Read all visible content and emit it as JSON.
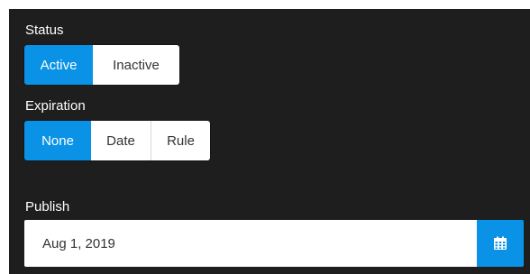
{
  "status": {
    "label": "Status",
    "options": [
      "Active",
      "Inactive"
    ],
    "selected": "Active"
  },
  "expiration": {
    "label": "Expiration",
    "options": [
      "None",
      "Date",
      "Rule"
    ],
    "selected": "None"
  },
  "publish": {
    "label": "Publish",
    "value": "Aug 1, 2019",
    "icon": "calendar-icon"
  },
  "colors": {
    "accent": "#0a93e6",
    "panel": "#1e1e1e",
    "button_bg": "#ffffff"
  }
}
